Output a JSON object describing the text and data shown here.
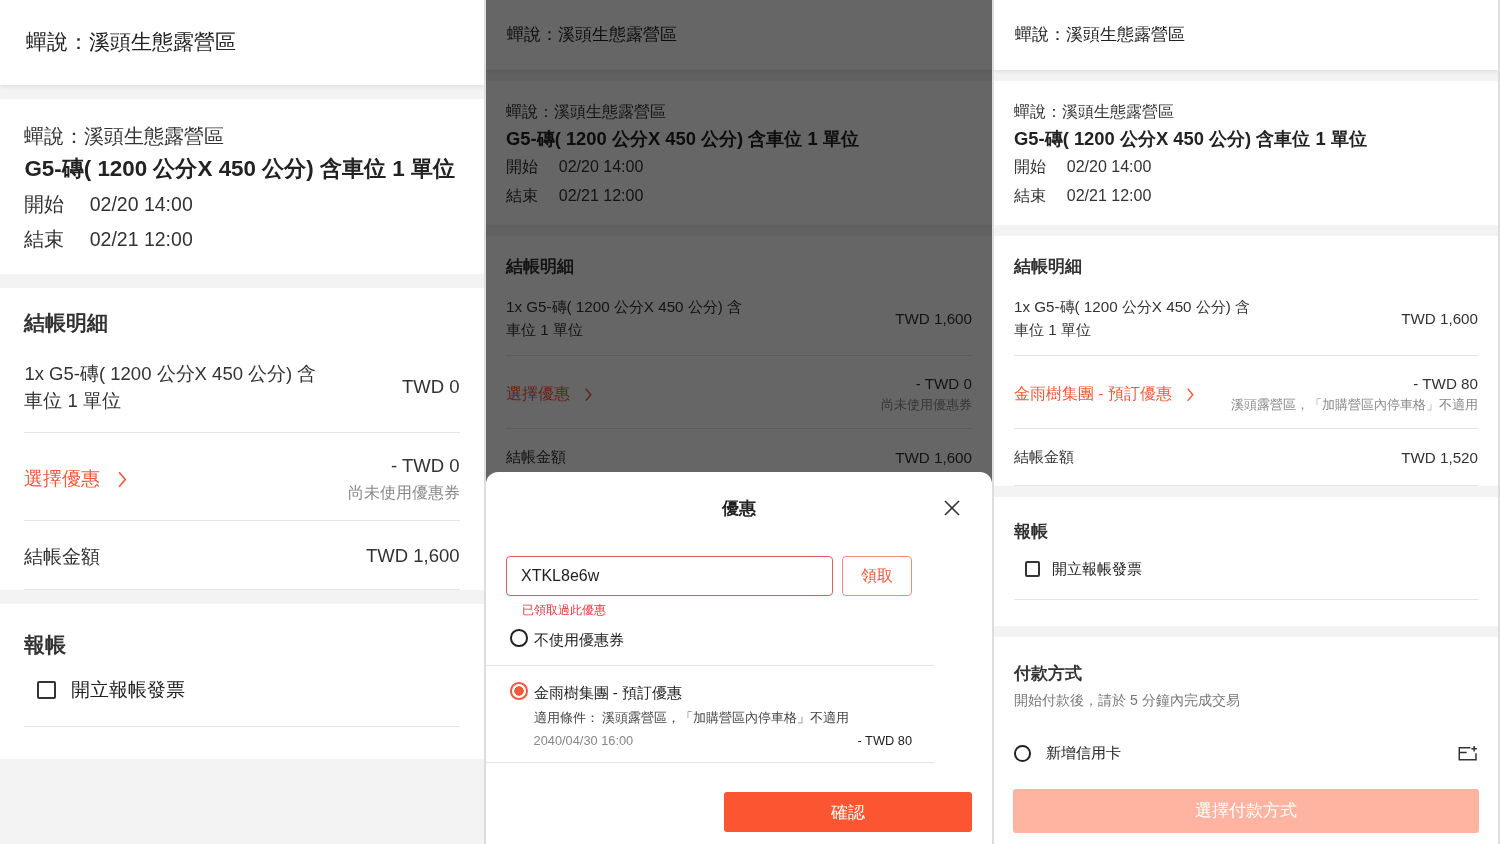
{
  "screens": [
    {
      "header": "蟬說：溪頭生態露營區",
      "booking": {
        "campsite": "蟬說：溪頭生態露營區",
        "unit": "G5-磚( 1200 公分X 450 公分) 含車位 1 單位",
        "start_label": "開始",
        "start": "02/20 14:00",
        "end_label": "結束",
        "end": "02/21 12:00"
      },
      "checkout": {
        "title": "結帳明細",
        "item": {
          "label": "1x G5-磚( 1200 公分X 450 公分) 含車位 1 單位",
          "price": "TWD 0"
        },
        "discount": {
          "label": "選擇優惠",
          "amount": "- TWD 0",
          "note": "尚未使用優惠券"
        },
        "total": {
          "label": "結帳金額",
          "amount": "TWD 1,600"
        }
      },
      "invoice": {
        "title": "報帳",
        "label": "開立報帳發票",
        "checked": false
      }
    },
    {
      "header": "蟬說：溪頭生態露營區",
      "booking": {
        "campsite": "蟬說：溪頭生態露營區",
        "unit": "G5-磚( 1200 公分X 450 公分) 含車位 1 單位",
        "start_label": "開始",
        "start": "02/20 14:00",
        "end_label": "結束",
        "end": "02/21 12:00"
      },
      "checkout": {
        "title": "結帳明細",
        "item": {
          "label": "1x G5-磚( 1200 公分X 450 公分) 含車位 1 單位",
          "price": "TWD 1,600"
        },
        "discount": {
          "label": "選擇優惠",
          "amount": "- TWD 0",
          "note": "尚未使用優惠券"
        },
        "total": {
          "label": "結帳金額",
          "amount": "TWD 1,600"
        }
      },
      "dialog": {
        "title": "優惠",
        "code": "XTKL8e6w",
        "claim": "領取",
        "error": "已領取過此優惠",
        "options": [
          {
            "label": "不使用優惠券",
            "selected": false
          },
          {
            "label": "金雨樹集團 - 預訂優惠",
            "selected": true,
            "condition": "適用條件： 溪頭露營區，「加購營區內停車格」不適用",
            "expiry": "2040/04/30 16:00",
            "amount": "- TWD 80"
          }
        ],
        "confirm": "確認"
      }
    },
    {
      "header": "蟬說：溪頭生態露營區",
      "booking": {
        "campsite": "蟬說：溪頭生態露營區",
        "unit": "G5-磚( 1200 公分X 450 公分) 含車位 1 單位",
        "start_label": "開始",
        "start": "02/20 14:00",
        "end_label": "結束",
        "end": "02/21 12:00"
      },
      "checkout": {
        "title": "結帳明細",
        "item": {
          "label": "1x G5-磚( 1200 公分X 450 公分) 含車位 1 單位",
          "price": "TWD 1,600"
        },
        "discount": {
          "label": "金雨樹集團 - 預訂優惠",
          "amount": "- TWD 80",
          "note": "溪頭露營區，「加購營區內停車格」不適用"
        },
        "total": {
          "label": "結帳金額",
          "amount": "TWD 1,520"
        }
      },
      "invoice": {
        "title": "報帳",
        "label": "開立報帳發票",
        "checked": false
      },
      "payment": {
        "title": "付款方式",
        "note": "開始付款後，請於 5 分鐘內完成交易",
        "option": {
          "label": "新增信用卡",
          "selected": false
        },
        "button": {
          "label": "選擇付款方式",
          "disabled": true
        }
      }
    }
  ]
}
